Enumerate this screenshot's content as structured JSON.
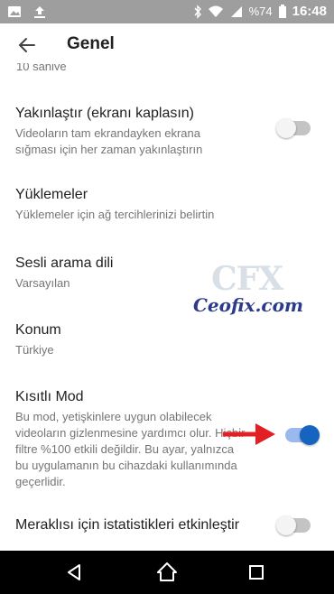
{
  "status_bar": {
    "battery": "%74",
    "time": "16:48"
  },
  "header": {
    "title": "Genel"
  },
  "cut_off_text": "10 saniye",
  "settings": [
    {
      "title": "Yakınlaştır (ekranı kaplasın)",
      "desc": "Videoların tam ekrandayken ekrana sığması için her zaman yakınlaştırın",
      "toggle": false
    },
    {
      "title": "Yüklemeler",
      "desc": "Yüklemeler için ağ tercihlerinizi belirtin"
    },
    {
      "title": "Sesli arama dili",
      "desc": "Varsayılan"
    },
    {
      "title": "Konum",
      "desc": "Türkiye"
    },
    {
      "title": "Kısıtlı Mod",
      "desc": "Bu mod, yetişkinlere uygun olabilecek videoların gizlenmesine yardımcı olur. Hiçbir filtre %100 etkili değildir. Bu ayar, yalnızca bu uygulamanın bu cihazdaki kullanımında geçerlidir.",
      "toggle": true
    },
    {
      "title": "Meraklısı için istatistikleri etkinleştir",
      "toggle": false
    }
  ],
  "watermark": {
    "logo": "CFX",
    "url": "Ceofix.com"
  },
  "colors": {
    "status_bar": "#9e9e9e",
    "toggle_on": "#1565c0",
    "arrow": "#e31e24"
  }
}
